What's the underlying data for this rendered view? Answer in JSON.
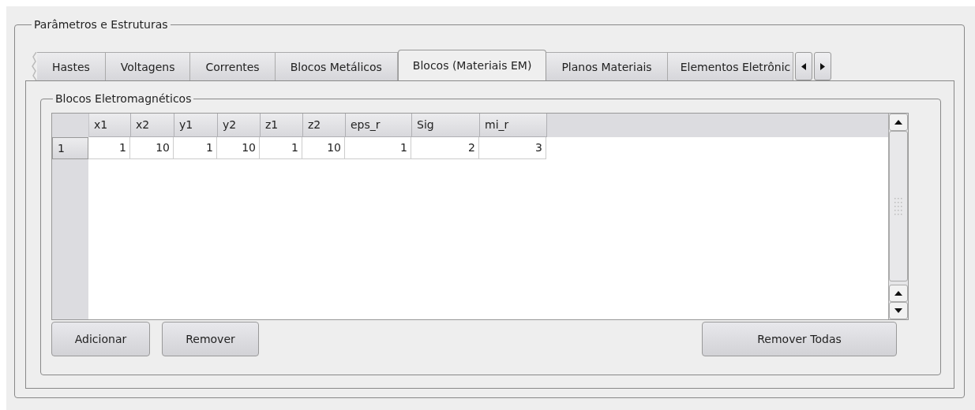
{
  "group_title": "Parâmetros e Estruturas",
  "tabs": [
    {
      "label": "Hastes",
      "selected": false
    },
    {
      "label": "Voltagens",
      "selected": false
    },
    {
      "label": "Correntes",
      "selected": false
    },
    {
      "label": "Blocos Metálicos",
      "selected": false
    },
    {
      "label": "Blocos (Materiais EM)",
      "selected": true
    },
    {
      "label": "Planos Materiais",
      "selected": false
    },
    {
      "label": "Elementos Eletrônic",
      "selected": false
    }
  ],
  "inner_group_title": "Blocos Eletromagnéticos",
  "table": {
    "columns": [
      "x1",
      "x2",
      "y1",
      "y2",
      "z1",
      "z2",
      "eps_r",
      "Sig",
      "mi_r"
    ],
    "rows": [
      {
        "header": "1",
        "cells": [
          "1",
          "10",
          "1",
          "10",
          "1",
          "10",
          "1",
          "2",
          "3"
        ]
      }
    ]
  },
  "buttons": [
    "Adicionar",
    "Remover",
    "Remover Todas"
  ]
}
